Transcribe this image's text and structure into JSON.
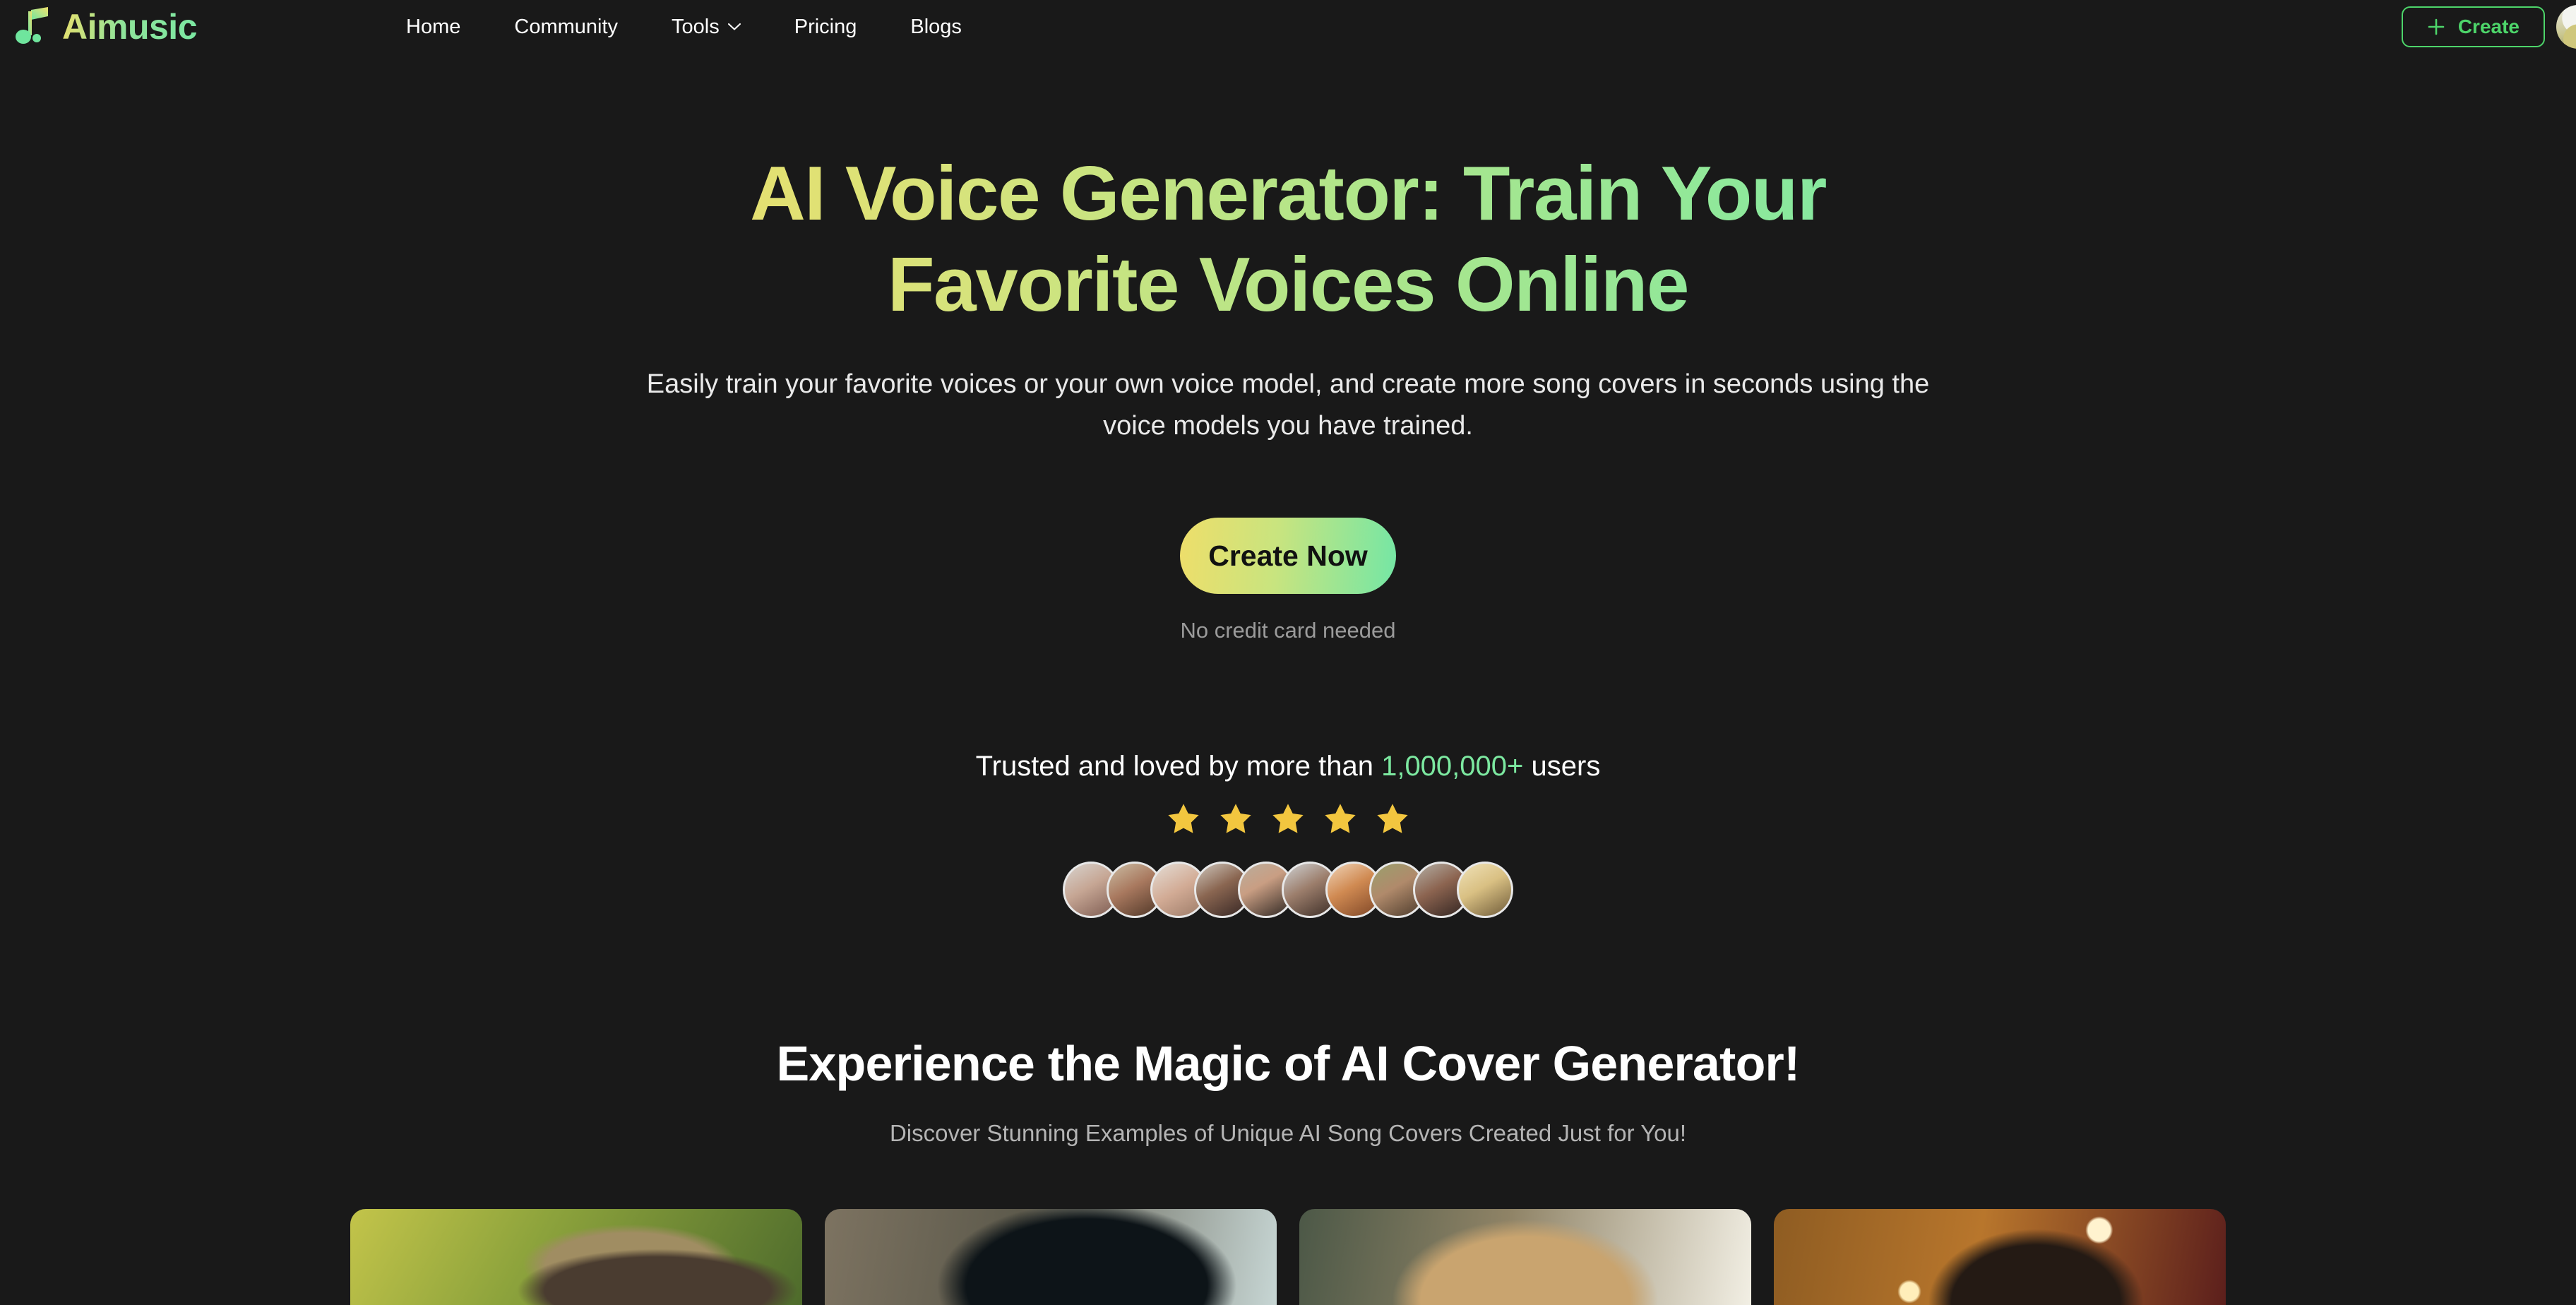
{
  "brand": {
    "name": "Aimusic",
    "icon": "music-note-icon"
  },
  "nav": {
    "items": [
      {
        "label": "Home",
        "has_chevron": false
      },
      {
        "label": "Community",
        "has_chevron": false
      },
      {
        "label": "Tools",
        "has_chevron": true
      },
      {
        "label": "Pricing",
        "has_chevron": false
      },
      {
        "label": "Blogs",
        "has_chevron": false
      }
    ],
    "create_button": {
      "label": "Create",
      "icon": "plus-icon",
      "border_color": "#4dd56a",
      "text_color": "#4dd56a"
    },
    "avatar": "user-avatar"
  },
  "hero": {
    "title": "AI Voice Generator: Train Your Favorite Voices Online",
    "subtitle": "Easily train your favorite voices or your own voice model, and create more song covers in seconds using the voice models you have trained.",
    "cta_label": "Create Now",
    "cta_note": "No credit card needed",
    "title_gradient_from": "#ecdf6b",
    "title_gradient_to": "#7ce9a4"
  },
  "social_proof": {
    "text_before": "Trusted and loved by more than ",
    "highlight": "1,000,000+",
    "text_after": " users",
    "highlight_color": "#7ce8a0",
    "star_count": 5,
    "star_color": "#f2c63f",
    "avatar_count": 10,
    "avatars": [
      "avatar-1",
      "avatar-2",
      "avatar-3",
      "avatar-4",
      "avatar-5",
      "avatar-6",
      "avatar-7",
      "avatar-8",
      "avatar-9",
      "avatar-10"
    ]
  },
  "examples_section": {
    "title": "Experience the Magic of AI Cover Generator!",
    "subtitle": "Discover Stunning Examples of Unique AI Song Covers Created Just for You!",
    "cards": [
      {
        "name": "cover-card-1"
      },
      {
        "name": "cover-card-2"
      },
      {
        "name": "cover-card-3"
      },
      {
        "name": "cover-card-4"
      }
    ]
  },
  "theme": {
    "background": "#191919",
    "text_primary": "#ffffff",
    "text_muted": "#9b9b9b",
    "accent_green": "#7ce8a0",
    "accent_yellow": "#ecdf6b"
  }
}
